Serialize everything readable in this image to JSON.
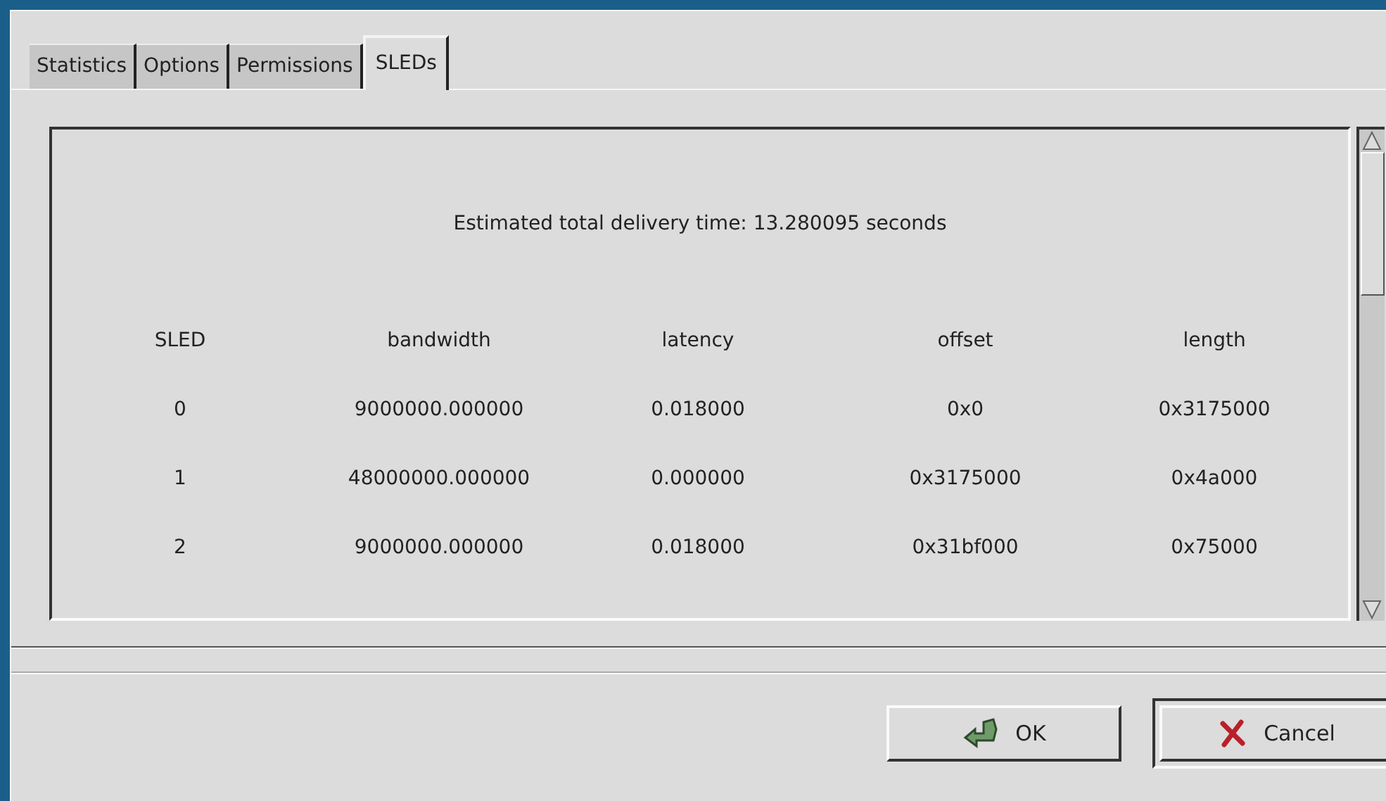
{
  "tabs": [
    {
      "label": "Statistics",
      "selected": false
    },
    {
      "label": "Options",
      "selected": false
    },
    {
      "label": "Permissions",
      "selected": false
    },
    {
      "label": "SLEDs",
      "selected": true
    }
  ],
  "summary": "Estimated total delivery time: 13.280095 seconds",
  "table": {
    "columns": [
      "SLED",
      "bandwidth",
      "latency",
      "offset",
      "length"
    ],
    "rows": [
      [
        "0",
        "9000000.000000",
        "0.018000",
        "0x0",
        "0x3175000"
      ],
      [
        "1",
        "48000000.000000",
        "0.000000",
        "0x3175000",
        "0x4a000"
      ],
      [
        "2",
        "9000000.000000",
        "0.018000",
        "0x31bf000",
        "0x75000"
      ]
    ]
  },
  "buttons": [
    {
      "label": "OK",
      "kind": "ok",
      "default": false
    },
    {
      "label": "Cancel",
      "kind": "cancel",
      "default": true
    }
  ]
}
